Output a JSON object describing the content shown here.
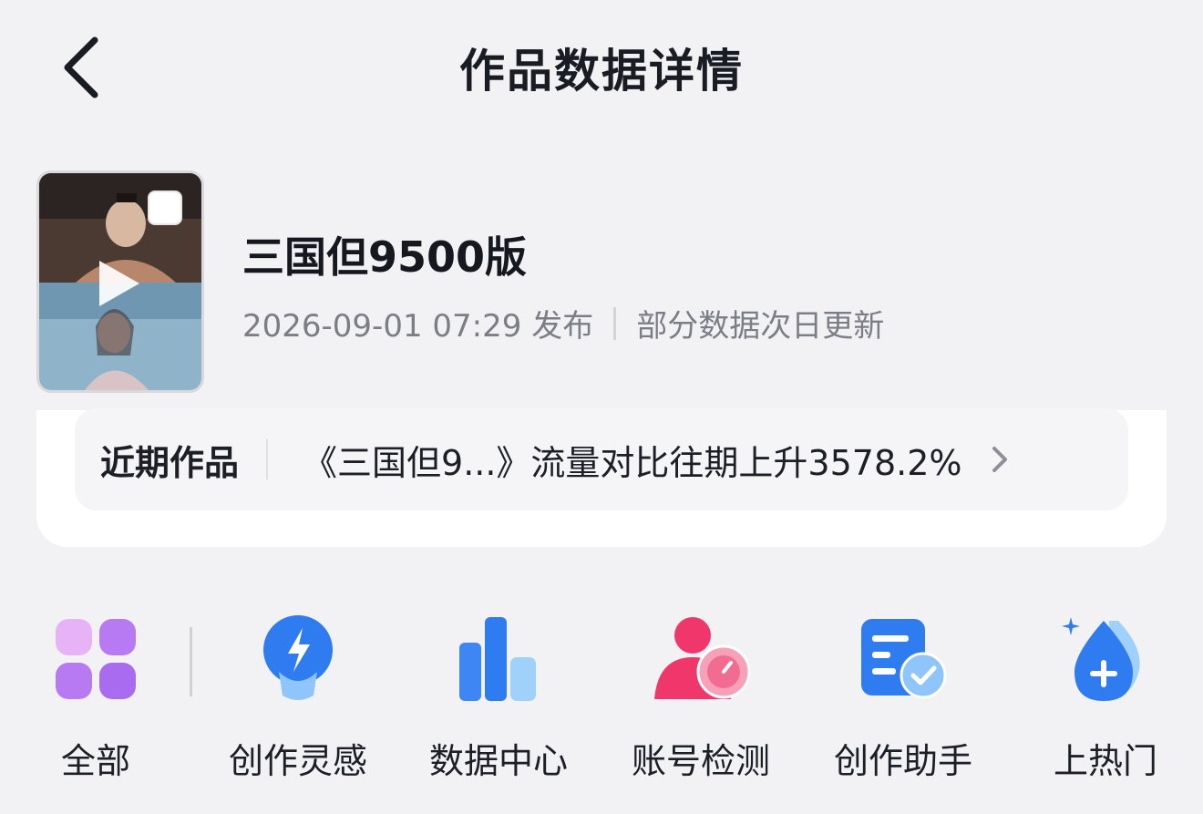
{
  "header": {
    "title": "作品数据详情"
  },
  "video": {
    "title": "三国但9500版",
    "publish_time": "2026-09-01 07:29 发布",
    "update_note": "部分数据次日更新"
  },
  "recent": {
    "label": "近期作品",
    "text": "《三国但9...》流量对比往期上升3578.2%"
  },
  "shortcuts": [
    {
      "label": "全部",
      "icon": "grid-icon"
    },
    {
      "label": "创作灵感",
      "icon": "lightbulb-icon"
    },
    {
      "label": "数据中心",
      "icon": "bar-chart-icon"
    },
    {
      "label": "账号检测",
      "icon": "account-check-icon"
    },
    {
      "label": "创作助手",
      "icon": "assistant-doc-icon"
    },
    {
      "label": "上热门",
      "icon": "boost-drop-icon"
    }
  ],
  "colors": {
    "background": "#f2f2f4",
    "accent_blue": "#2f7bf0",
    "accent_pink": "#f0376b",
    "accent_purple": "#b77af3"
  }
}
